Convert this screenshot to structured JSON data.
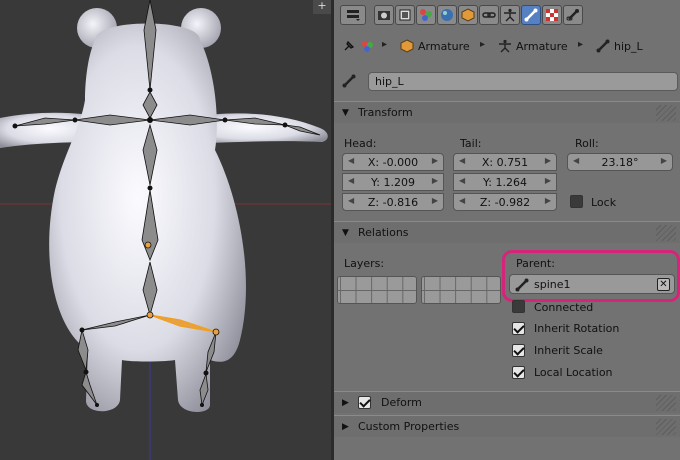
{
  "viewport": {
    "corner_label": "+",
    "colors": {
      "background": "#393939",
      "mesh": "#e6e6ee",
      "bone": "#8c8c8c",
      "selected_bone": "#f0a020"
    }
  },
  "tabs": [
    {
      "icon": "render-icon"
    },
    {
      "icon": "render-layers-icon"
    },
    {
      "icon": "scene-icon"
    },
    {
      "icon": "world-icon"
    },
    {
      "icon": "object-icon"
    },
    {
      "icon": "constraints-icon"
    },
    {
      "icon": "armature-data-icon"
    },
    {
      "icon": "bone-icon",
      "active": true
    },
    {
      "icon": "material-icon"
    },
    {
      "icon": "bone-constraints-icon"
    }
  ],
  "breadcrumb": {
    "object": "Armature",
    "data": "Armature",
    "bone": "hip_L"
  },
  "bone_name": "hip_L",
  "transform": {
    "title": "Transform",
    "head_label": "Head:",
    "tail_label": "Tail:",
    "roll_label": "Roll:",
    "head": {
      "x": "X: -0.000",
      "y": "Y: 1.209",
      "z": "Z: -0.816"
    },
    "tail": {
      "x": "X: 0.751",
      "y": "Y: 1.264",
      "z": "Z: -0.982"
    },
    "roll": "23.18°",
    "lock_label": "Lock",
    "lock_checked": false
  },
  "relations": {
    "title": "Relations",
    "layers_label": "Layers:",
    "parent_label": "Parent:",
    "parent_value": "spine1",
    "clear_glyph": "✕",
    "connected_label": "Connected",
    "connected_checked": false,
    "inherit_rotation_label": "Inherit Rotation",
    "inherit_rotation_checked": true,
    "inherit_scale_label": "Inherit Scale",
    "inherit_scale_checked": true,
    "local_location_label": "Local Location",
    "local_location_checked": true
  },
  "deform": {
    "title": "Deform",
    "checked": true
  },
  "custom_properties": {
    "title": "Custom Properties"
  },
  "colors": {
    "active_tab": "#5680c2",
    "highlight": "#d6247a",
    "panel": "#727272"
  }
}
